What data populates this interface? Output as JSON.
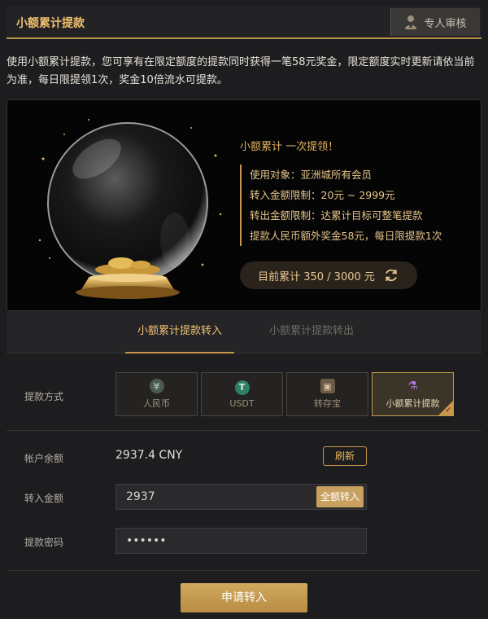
{
  "header": {
    "title": "小额累计提款",
    "review_label": "专人审核"
  },
  "intro": "使用小额累计提款，您可享有在限定额度的提款同时获得一笔58元奖金，限定额度实时更新请依当前为准，每日限提领1次，奖金10倍流水可提款。",
  "promo": {
    "headline": "小额累计 一次提领！",
    "items": [
      "使用对象：亚洲城所有会员",
      "转入金额限制：20元 ~ 2999元",
      "转出金额限制：达累计目标可整笔提款",
      "提款人民币额外奖金58元，每日限提款1次"
    ],
    "progress_text": "目前累计 350 / 3000 元",
    "progress": {
      "current": 350,
      "target": 3000
    }
  },
  "tabs": [
    {
      "label": "小额累计提款转入",
      "active": true
    },
    {
      "label": "小额累计提款转出",
      "active": false
    }
  ],
  "form": {
    "method_label": "提款方式",
    "methods": [
      {
        "label": "人民币",
        "icon": "yuan-icon",
        "glyph": "¥",
        "selected": false
      },
      {
        "label": "USDT",
        "icon": "tether-icon",
        "glyph": "T",
        "selected": false
      },
      {
        "label": "转存宝",
        "icon": "treasure-box-icon",
        "glyph": "▣",
        "selected": false
      },
      {
        "label": "小额累计提款",
        "icon": "flask-icon",
        "glyph": "⚗",
        "selected": true
      }
    ],
    "balance_label": "帐户余额",
    "balance_value": "2937.4 CNY",
    "refresh_label": "刷新",
    "amount_label": "转入金额",
    "amount_value": "2937",
    "all_in_label": "全额转入",
    "password_label": "提款密码",
    "password_value": "••••••",
    "submit_label": "申请转入"
  },
  "colors": {
    "accent": "#c9974b",
    "headline": "#f0c070",
    "background": "#1d1d1f"
  }
}
